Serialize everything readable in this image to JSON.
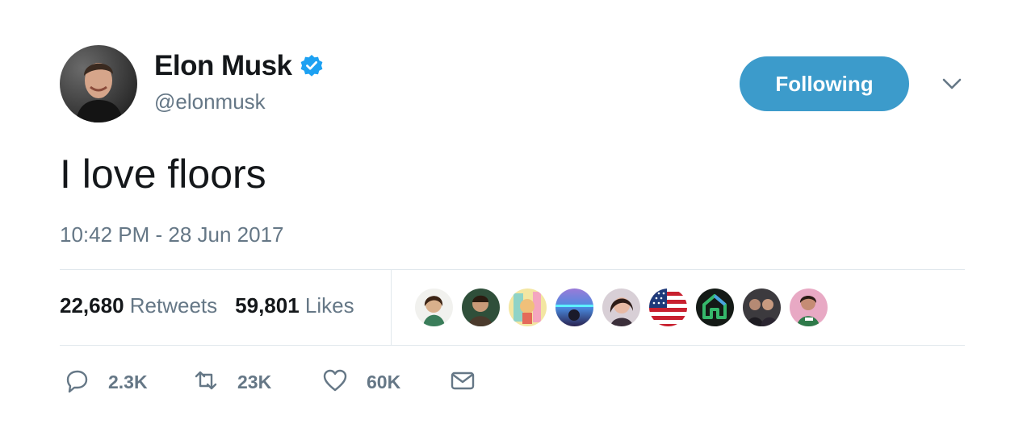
{
  "author": {
    "display_name": "Elon Musk",
    "handle": "@elonmusk",
    "verified": true,
    "verified_color": "#1da1f2"
  },
  "follow_button": {
    "label": "Following",
    "color": "#3c9bcb"
  },
  "tweet": {
    "text": "I love floors",
    "timestamp": "10:42 PM - 28 Jun 2017"
  },
  "stats": {
    "retweets_count": "22,680",
    "retweets_label": "Retweets",
    "likes_count": "59,801",
    "likes_label": "Likes"
  },
  "likers": [
    {
      "icon": "avatar-1"
    },
    {
      "icon": "avatar-2"
    },
    {
      "icon": "avatar-3"
    },
    {
      "icon": "avatar-4"
    },
    {
      "icon": "avatar-5"
    },
    {
      "icon": "avatar-6-flag"
    },
    {
      "icon": "avatar-7-logo"
    },
    {
      "icon": "avatar-8"
    },
    {
      "icon": "avatar-9"
    }
  ],
  "actions": {
    "reply_count": "2.3K",
    "retweet_count": "23K",
    "like_count": "60K"
  }
}
